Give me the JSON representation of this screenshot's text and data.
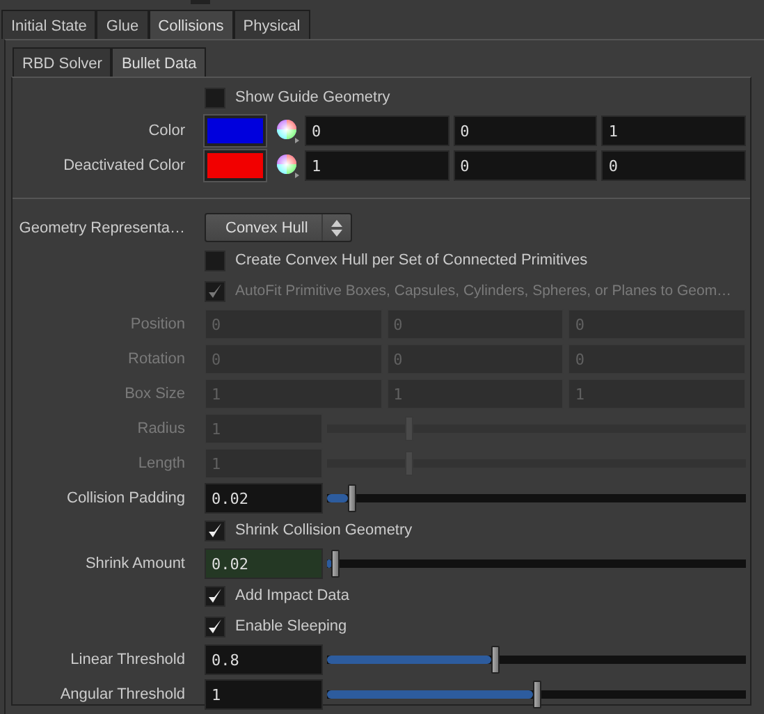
{
  "tabs": [
    {
      "label": "Initial State",
      "selected": false
    },
    {
      "label": "Glue",
      "selected": false
    },
    {
      "label": "Collisions",
      "selected": true
    },
    {
      "label": "Physical",
      "selected": false
    }
  ],
  "subtabs": [
    {
      "label": "RBD Solver",
      "selected": false
    },
    {
      "label": "Bullet Data",
      "selected": true
    }
  ],
  "params": [
    {
      "kind": "checkbox",
      "text": "Show Guide Geometry",
      "checked": false,
      "disabled": false
    },
    {
      "kind": "color",
      "label": "Color",
      "color": "#0000dd",
      "values": [
        "0",
        "0",
        "1"
      ]
    },
    {
      "kind": "color",
      "label": "Deactivated Color",
      "color": "#f20000",
      "values": [
        "1",
        "0",
        "0"
      ]
    },
    {
      "kind": "separator"
    },
    {
      "kind": "menu",
      "label": "Geometry Representa…",
      "value": "Convex Hull"
    },
    {
      "kind": "checkbox",
      "text": "Create Convex Hull per Set of Connected Primitives",
      "checked": false,
      "disabled": false
    },
    {
      "kind": "checkbox",
      "text": "AutoFit Primitive Boxes, Capsules, Cylinders, Spheres, or Planes to Geom…",
      "checked": true,
      "disabled": true
    },
    {
      "kind": "vector",
      "label": "Position",
      "values": [
        "0",
        "0",
        "0"
      ],
      "disabled": true
    },
    {
      "kind": "vector",
      "label": "Rotation",
      "values": [
        "0",
        "0",
        "0"
      ],
      "disabled": true
    },
    {
      "kind": "vector",
      "label": "Box Size",
      "values": [
        "1",
        "1",
        "1"
      ],
      "disabled": true
    },
    {
      "kind": "slider",
      "label": "Radius",
      "value": "1",
      "level": 0.19,
      "disabled": true,
      "highlighted": false
    },
    {
      "kind": "slider",
      "label": "Length",
      "value": "1",
      "level": 0.19,
      "disabled": true,
      "highlighted": false
    },
    {
      "kind": "slider",
      "label": "Collision Padding",
      "value": "0.02",
      "level": 0.05,
      "disabled": false,
      "highlighted": false
    },
    {
      "kind": "checkbox",
      "text": "Shrink Collision Geometry",
      "checked": true,
      "disabled": false
    },
    {
      "kind": "slider",
      "label": "Shrink Amount",
      "value": "0.02",
      "level": 0.01,
      "disabled": false,
      "highlighted": true
    },
    {
      "kind": "checkbox",
      "text": "Add Impact Data",
      "checked": true,
      "disabled": false
    },
    {
      "kind": "checkbox",
      "text": "Enable Sleeping",
      "checked": true,
      "disabled": false
    },
    {
      "kind": "slider",
      "label": "Linear Threshold",
      "value": "0.8",
      "level": 0.4,
      "disabled": false,
      "highlighted": false
    },
    {
      "kind": "slider",
      "label": "Angular Threshold",
      "value": "1",
      "level": 0.5,
      "disabled": false,
      "highlighted": false
    }
  ]
}
